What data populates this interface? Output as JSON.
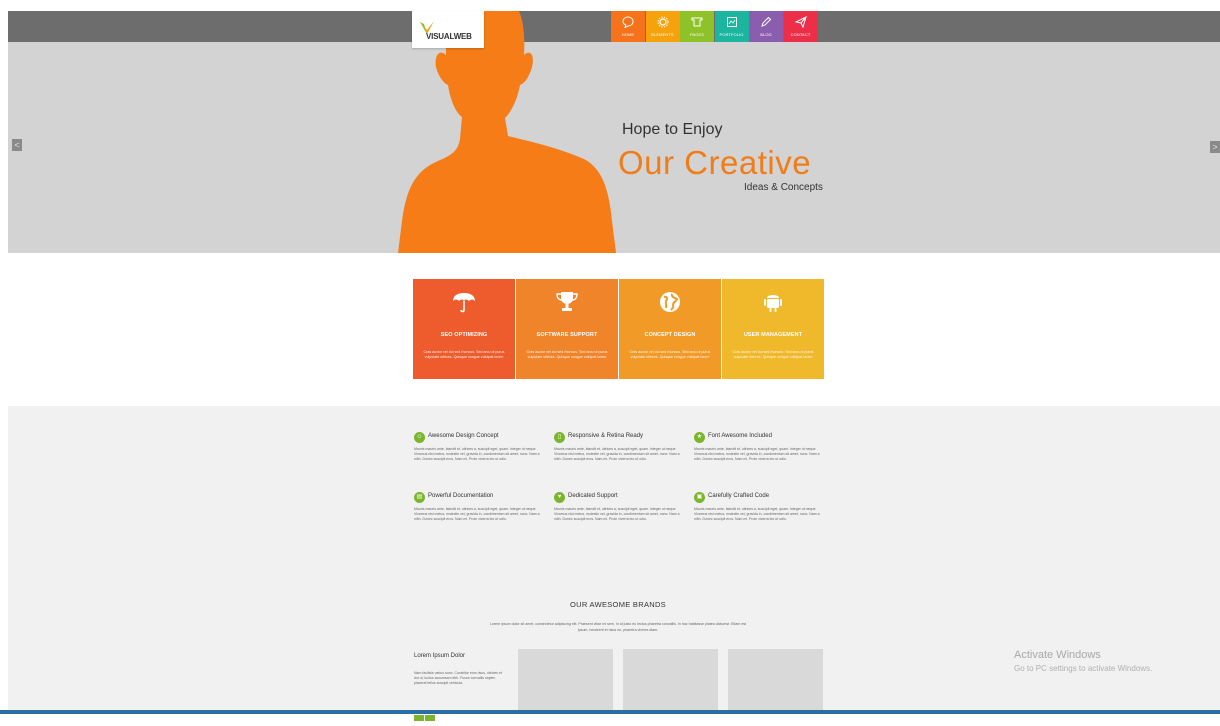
{
  "header": {
    "logo_text": "VISUALWEB",
    "nav": [
      {
        "label": "HOME",
        "icon": "chat-bubble-icon",
        "color": "#f6721b"
      },
      {
        "label": "ELEMENTS",
        "icon": "gear-icon",
        "color": "#f5a20c"
      },
      {
        "label": "PAGES",
        "icon": "hat-icon",
        "color": "#8ec228"
      },
      {
        "label": "PORTFOLIO",
        "icon": "picture-icon",
        "color": "#1cb59f"
      },
      {
        "label": "BLOG",
        "icon": "pencil-icon",
        "color": "#8b5dae"
      },
      {
        "label": "CONTACT",
        "icon": "paper-plane-icon",
        "color": "#ed2e49"
      }
    ]
  },
  "hero": {
    "line1": "Hope to Enjoy",
    "line2": "Our Creative",
    "line3": "Ideas & Concepts",
    "prev_arrow": "<",
    "next_arrow": ">",
    "accent": "#f07d1a"
  },
  "services": [
    {
      "title": "SEO OPTIMIZING",
      "icon": "umbrella-icon",
      "color": "#ee5c2e",
      "text": "Cras auctor vel dui sed rhoncus. Sed arcu ut purus vulputate ultrices. Quisque congue volutpat lorem"
    },
    {
      "title": "SOFTWARE SUPPORT",
      "icon": "trophy-icon",
      "color": "#f0842a",
      "text": "Cras auctor vel dui sed rhoncus. Sed arcu ut purus vulputate ultrices. Quisque congue volutpat lorem"
    },
    {
      "title": "CONCEPT DESIGN",
      "icon": "globe-icon",
      "color": "#f19a28",
      "text": "Cras auctor vel dui sed rhoncus. Sed arcu ut purus vulputate ultrices. Quisque congue volutpat lorem"
    },
    {
      "title": "USER MANAGEMENT",
      "icon": "android-icon",
      "color": "#f0b82b",
      "text": "Cras auctor vel dui sed rhoncus. Sed arcu ut purus vulputate ultrices. Quisque congue volutpat lorem"
    }
  ],
  "features": [
    {
      "title": "Awesome Design Concept",
      "icon": "user-icon",
      "text": "Mauris mauris ante, blandit et, ultrices a, suscipit eget, quam. Integer ut neque. Vivamus nisl metus, molestie vel, gravida in, condimentum sit amet, nunc. Nam a nibh. Donec suscipit eros. Nam mi. Proin viverra leo ut odio."
    },
    {
      "title": "Responsive & Retina Ready",
      "icon": "tablet-icon",
      "text": "Mauris mauris ante, blandit et, ultrices a, suscipit eget, quam. Integer ut neque. Vivamus nisl metus, molestie vel, gravida in, condimentum sit amet, nunc. Nam a nibh. Donec suscipit eros. Nam mi. Proin viverra leo ut odio."
    },
    {
      "title": "Font Awesome Included",
      "icon": "trophy-icon",
      "text": "Mauris mauris ante, blandit et, ultrices a, suscipit eget, quam. Integer ut neque. Vivamus nisl metus, molestie vel, gravida in, condimentum sit amet, nunc. Nam a nibh. Donec suscipit eros. Nam mi. Proin viverra leo ut odio."
    },
    {
      "title": "Powerful Documentation",
      "icon": "folder-icon",
      "text": "Mauris mauris ante, blandit et, ultrices a, suscipit eget, quam. Integer ut neque. Vivamus nisl metus, molestie vel, gravida in, condimentum sit amet, nunc. Nam a nibh. Donec suscipit eros. Nam mi. Proin viverra leo ut odio."
    },
    {
      "title": "Dedicated Support",
      "icon": "heart-icon",
      "text": "Mauris mauris ante, blandit et, ultrices a, suscipit eget, quam. Integer ut neque. Vivamus nisl metus, molestie vel, gravida in, condimentum sit amet, nunc. Nam a nibh. Donec suscipit eros. Nam mi. Proin viverra leo ut odio."
    },
    {
      "title": "Carefully Crafted Code",
      "icon": "lock-icon",
      "text": "Mauris mauris ante, blandit et, ultrices a, suscipit eget, quam. Integer ut neque. Vivamus nisl metus, molestie vel, gravida in, condimentum sit amet, nunc. Nam a nibh. Donec suscipit eros. Nam mi. Proin viverra leo ut odio."
    }
  ],
  "brands": {
    "title": "OUR AWESOME BRANDS",
    "subtitle": "Lorem ipsum dolor sit amet, consectetur adipiscing elit. Praesent vitae mi sem. In id justo eu lectus pharetra convallis. In hac habitasse platea dictumst. Etiam est ipsum, hendrerit et risus eu, pharetra viverra diam.",
    "side_title": "Lorem Ipsum Dolor",
    "side_text": "Nam facilisis varius nunc. Curabitur eros risus, ultrices et dui ut, luctus accumsan nibh. Fusce convallis sapien placerat tellus suscipit vehicula."
  },
  "watermark": {
    "line1": "Activate Windows",
    "line2": "Go to PC settings to activate Windows."
  }
}
